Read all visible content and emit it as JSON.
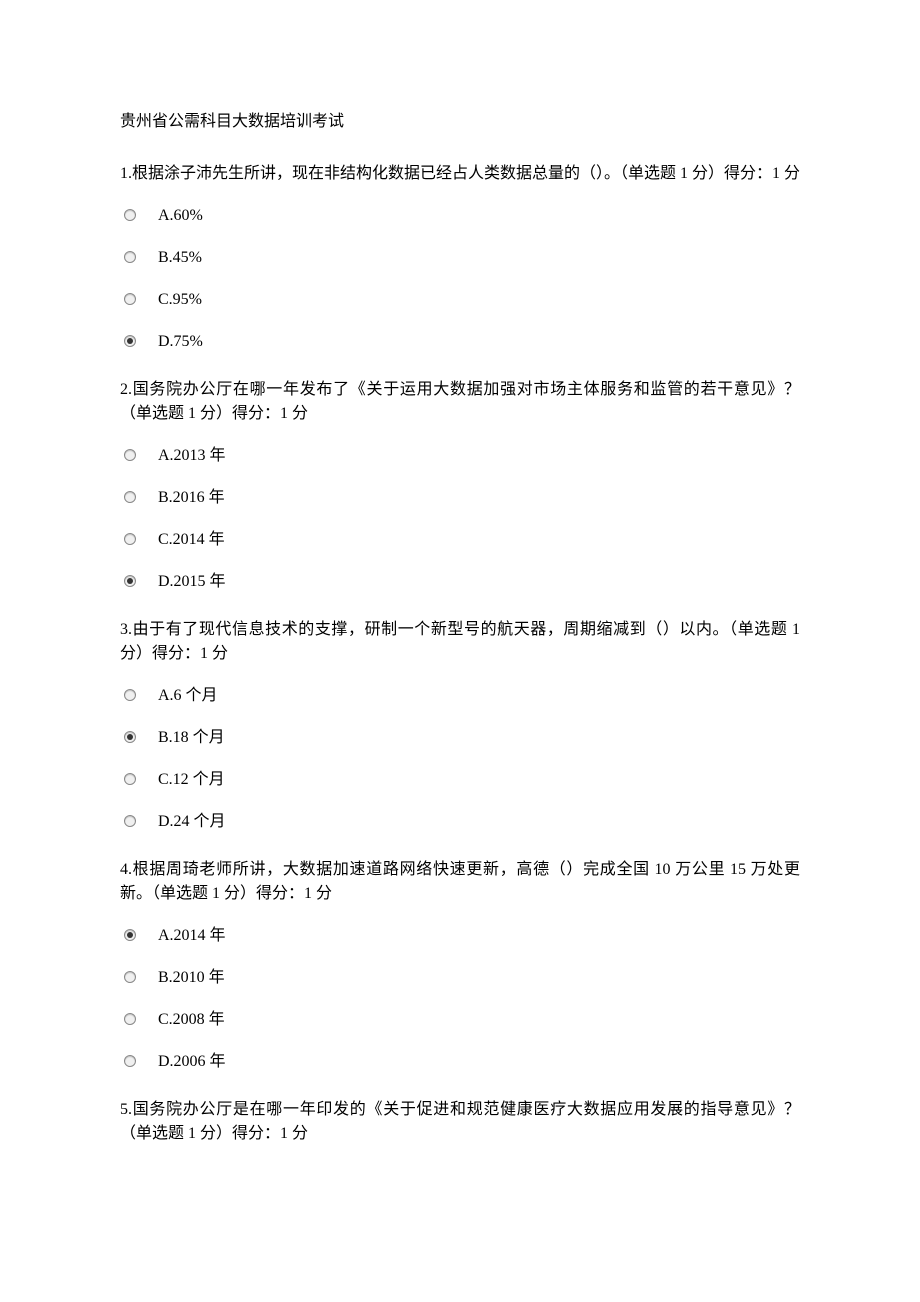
{
  "title": "贵州省公需科目大数据培训考试",
  "questions": [
    {
      "text": "1.根据涂子沛先生所讲，现在非结构化数据已经占人类数据总量的（）。（单选题 1 分）得分：1 分",
      "options": [
        "A.60%",
        "B.45%",
        "C.95%",
        "D.75%"
      ],
      "selected": 3
    },
    {
      "text": "2.国务院办公厅在哪一年发布了《关于运用大数据加强对市场主体服务和监管的若干意见》？（单选题 1 分）得分：1 分",
      "options": [
        "A.2013 年",
        "B.2016 年",
        "C.2014 年",
        "D.2015 年"
      ],
      "selected": 3
    },
    {
      "text": "3.由于有了现代信息技术的支撑，研制一个新型号的航天器，周期缩减到（）以内。（单选题 1 分）得分：1 分",
      "options": [
        "A.6 个月",
        "B.18 个月",
        "C.12 个月",
        "D.24 个月"
      ],
      "selected": 1
    },
    {
      "text": "4.根据周琦老师所讲，大数据加速道路网络快速更新，高德（）完成全国 10 万公里 15 万处更新。（单选题 1 分）得分：1 分",
      "options": [
        "A.2014 年",
        "B.2010 年",
        "C.2008 年",
        "D.2006 年"
      ],
      "selected": 0
    },
    {
      "text": "5.国务院办公厅是在哪一年印发的《关于促进和规范健康医疗大数据应用发展的指导意见》？（单选题 1 分）得分：1 分",
      "options": [],
      "selected": -1
    }
  ]
}
